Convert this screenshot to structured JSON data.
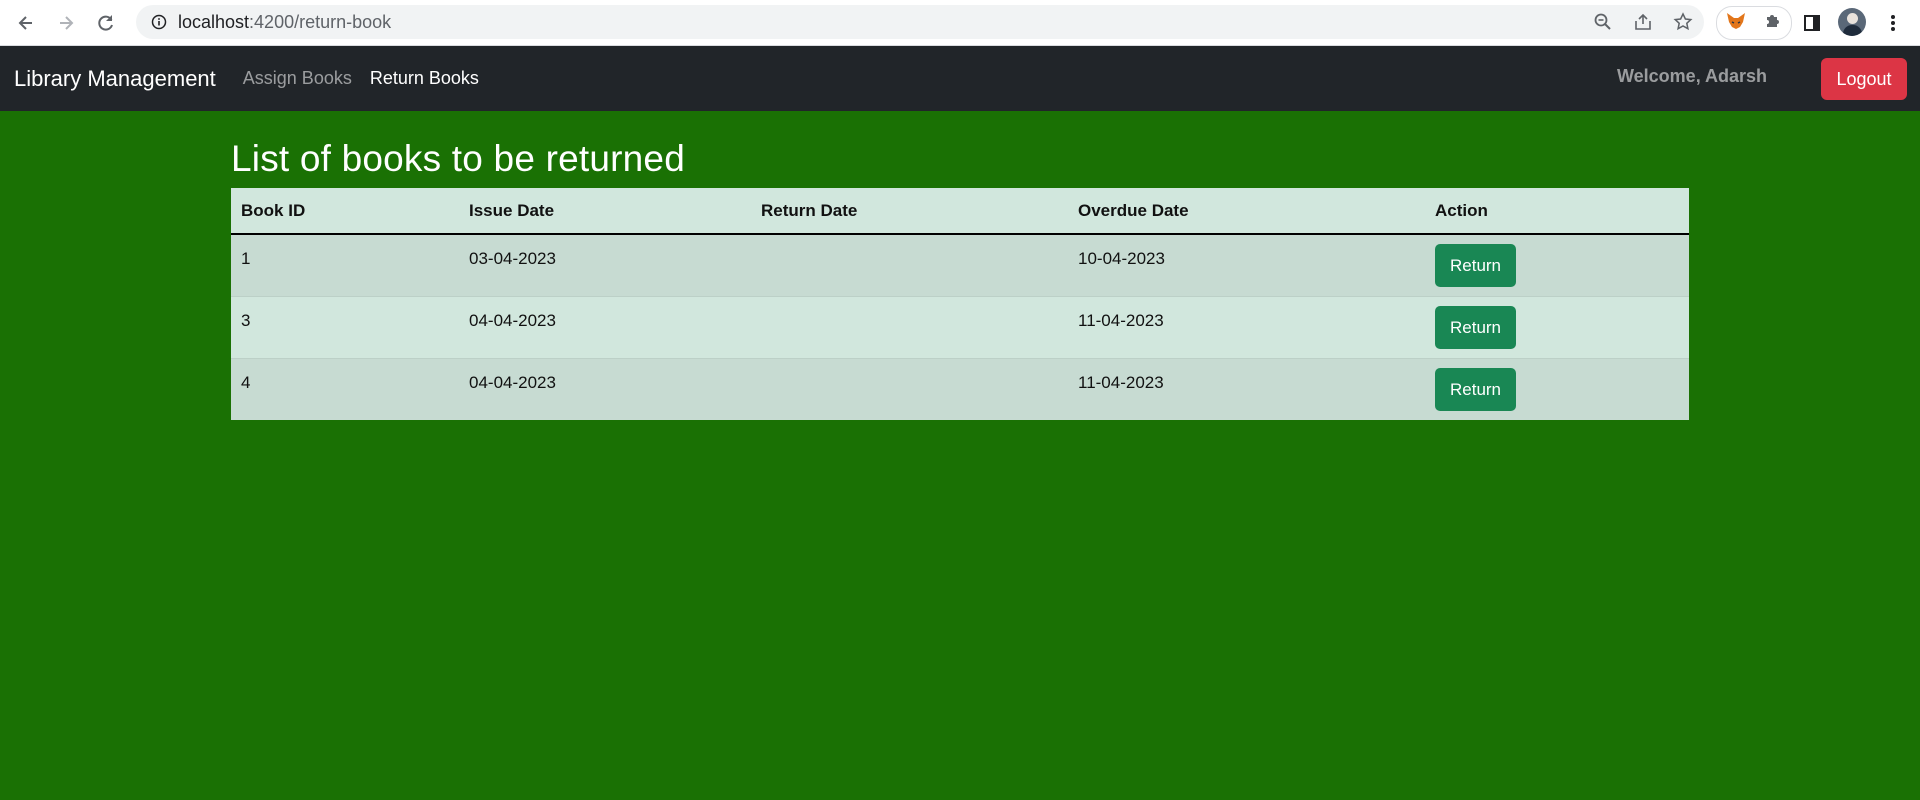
{
  "browser": {
    "url_host": "localhost",
    "url_path": ":4200/return-book",
    "icons": {
      "back": "back-arrow-icon",
      "forward": "forward-arrow-icon",
      "reload": "reload-icon",
      "site_info": "info-icon",
      "zoom": "zoom-icon",
      "share": "share-icon",
      "bookmark": "star-icon",
      "extension_1": "fox-extension-icon",
      "extensions": "puzzle-icon",
      "side_panel": "side-panel-icon",
      "menu": "kebab-menu-icon"
    }
  },
  "navbar": {
    "brand": "Library Management",
    "links": [
      {
        "label": "Assign Books",
        "active": false
      },
      {
        "label": "Return Books",
        "active": true
      }
    ],
    "welcome": "Welcome, Adarsh",
    "logout_label": "Logout"
  },
  "main": {
    "title": "List of books to be returned",
    "table": {
      "headers": [
        "Book ID",
        "Issue Date",
        "Return Date",
        "Overdue Date",
        "Action"
      ],
      "rows": [
        {
          "book_id": "1",
          "issue_date": "03-04-2023",
          "return_date": "",
          "overdue_date": "10-04-2023",
          "action": "Return"
        },
        {
          "book_id": "3",
          "issue_date": "04-04-2023",
          "return_date": "",
          "overdue_date": "11-04-2023",
          "action": "Return"
        },
        {
          "book_id": "4",
          "issue_date": "04-04-2023",
          "return_date": "",
          "overdue_date": "11-04-2023",
          "action": "Return"
        }
      ]
    }
  },
  "colors": {
    "page_background": "#1a7104",
    "navbar_background": "#212529",
    "logout_button": "#dc3545",
    "return_button": "#198754",
    "table_row": "#d1e7dd"
  }
}
